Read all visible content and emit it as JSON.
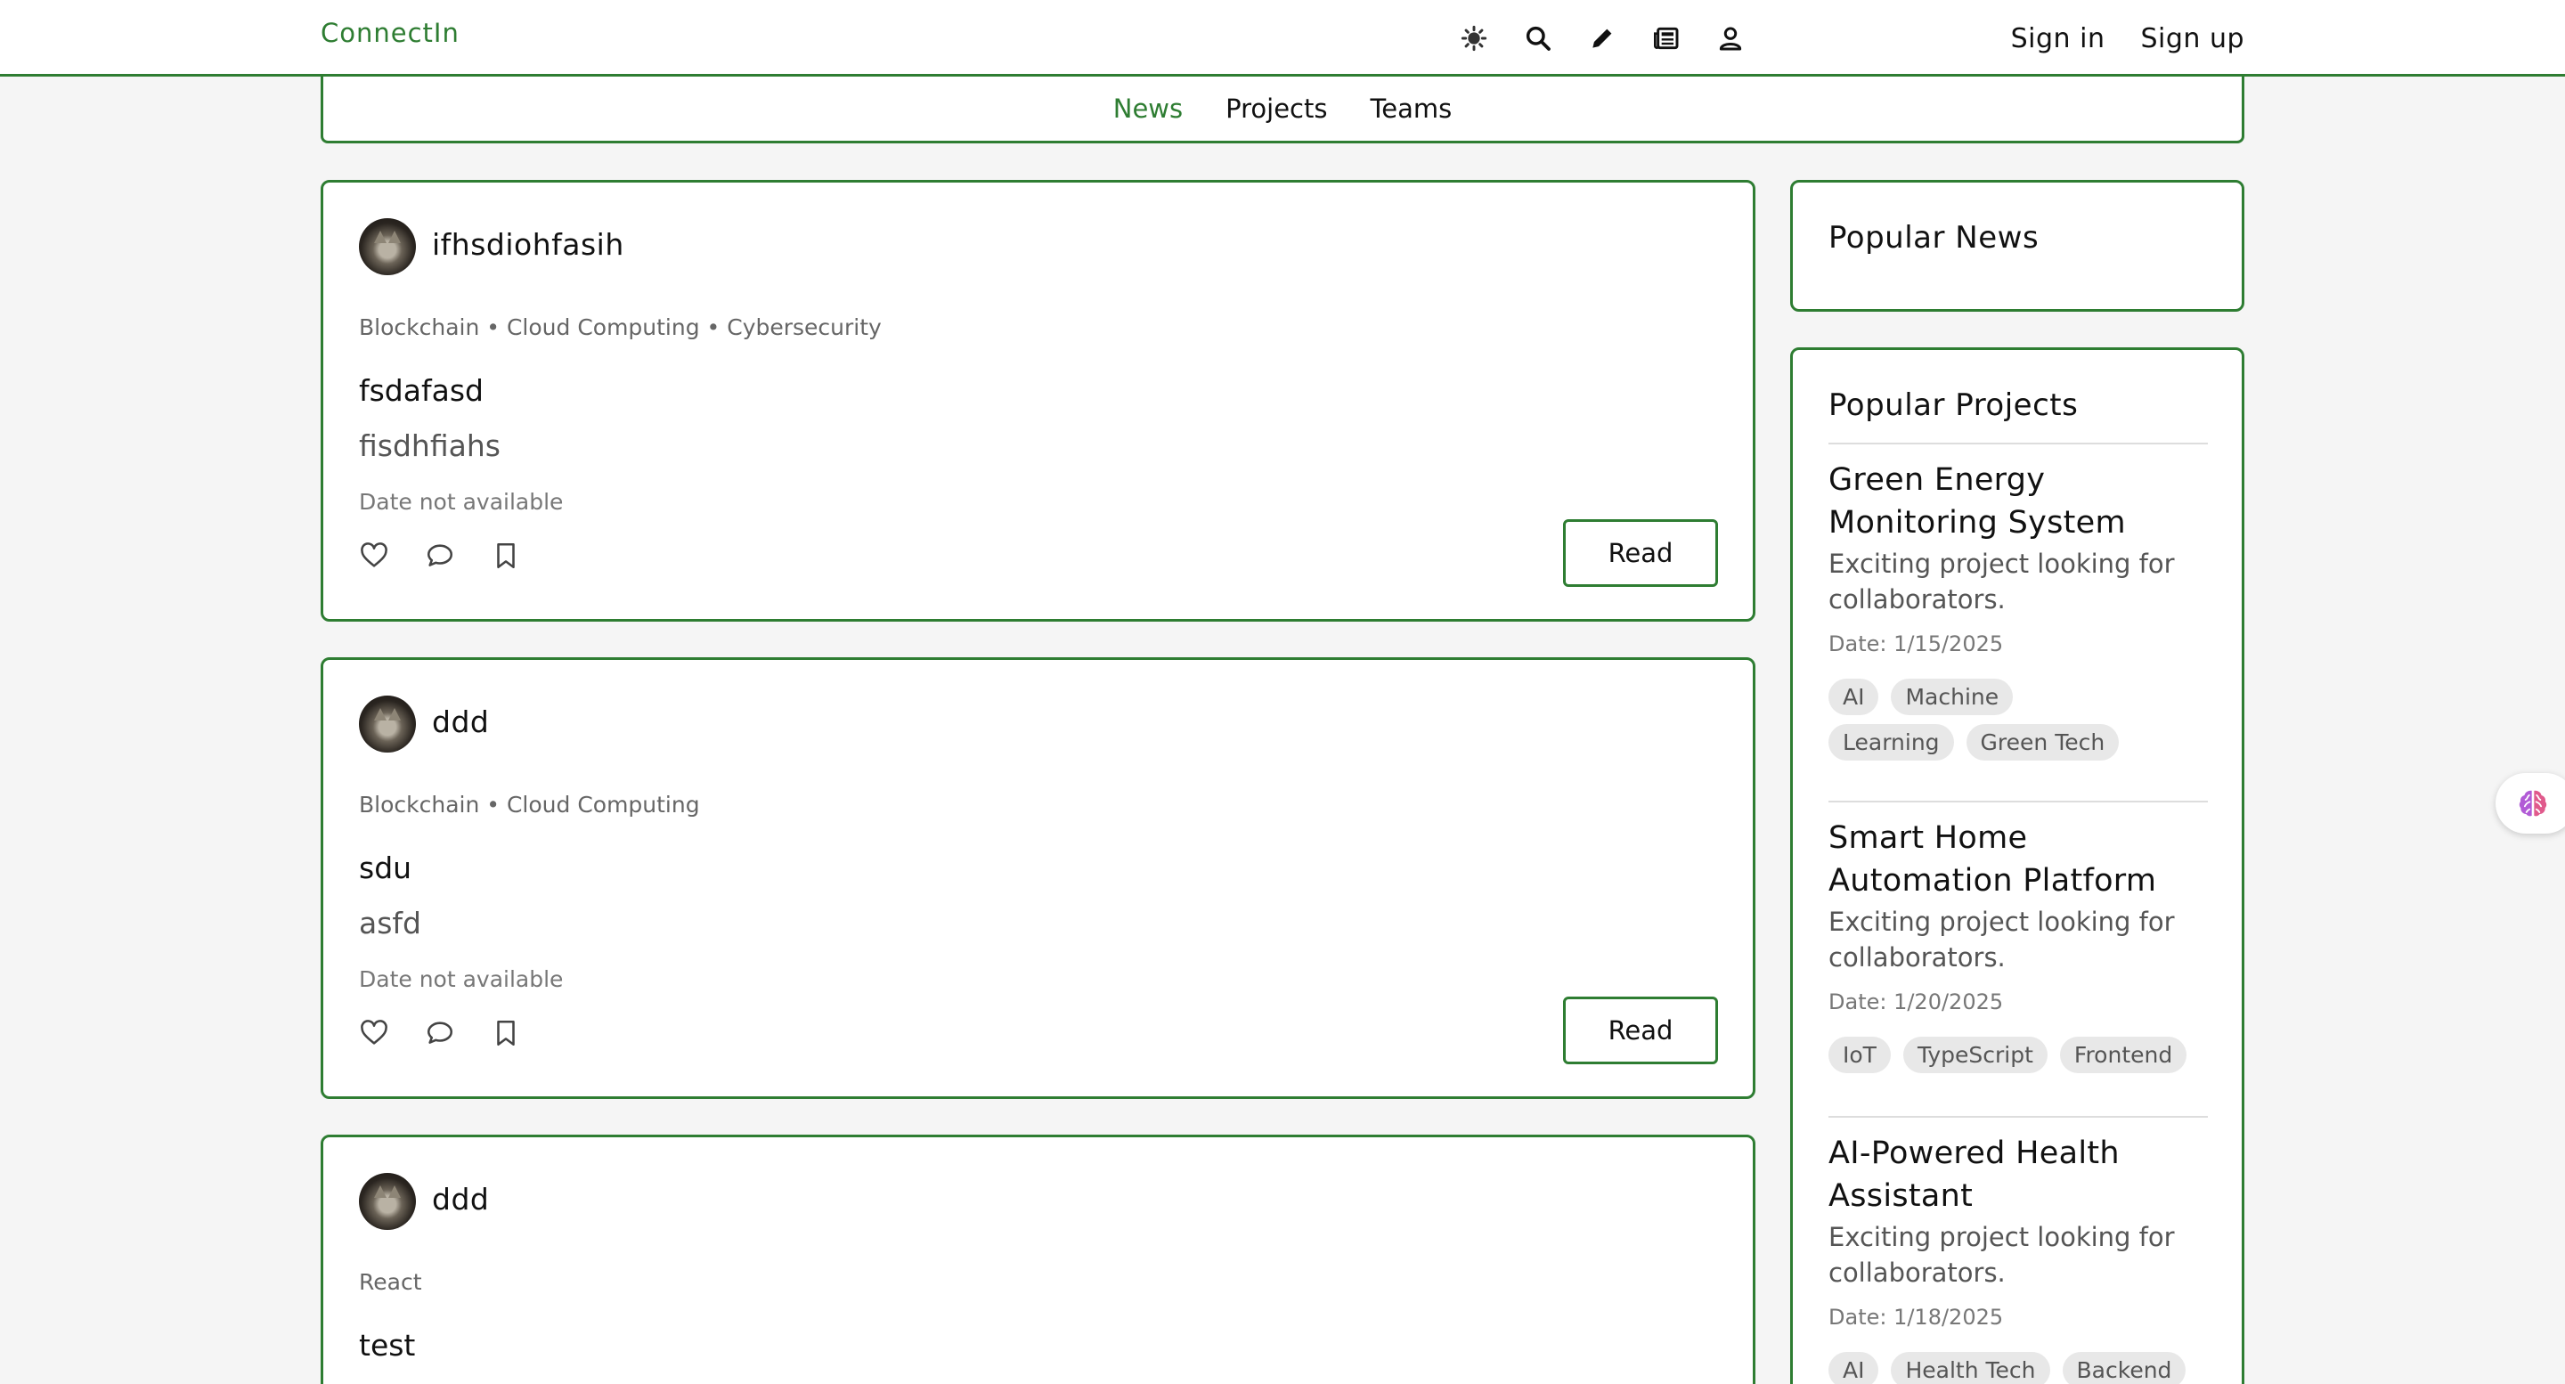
{
  "header": {
    "brand": "ConnectIn",
    "icons": [
      "theme-icon",
      "search-icon",
      "edit-icon",
      "newspaper-icon",
      "user-icon"
    ],
    "sign_in": "Sign in",
    "sign_up": "Sign up",
    "accent_color": "#2e7d32"
  },
  "tabs": [
    {
      "label": "News",
      "active": true
    },
    {
      "label": "Projects",
      "active": false
    },
    {
      "label": "Teams",
      "active": false
    }
  ],
  "posts": [
    {
      "author": "ifhsdiohfasih",
      "tags": "Blockchain • Cloud Computing • Cybersecurity",
      "title": "fsdafasd",
      "body": "fisdhfiahs",
      "date": "Date not available",
      "read_label": "Read"
    },
    {
      "author": "ddd",
      "tags": "Blockchain • Cloud Computing",
      "title": "sdu",
      "body": "asfd",
      "date": "Date not available",
      "read_label": "Read"
    },
    {
      "author": "ddd",
      "tags": "React",
      "title": "test"
    }
  ],
  "sidebar": {
    "popular_news_title": "Popular News",
    "popular_projects_title": "Popular Projects",
    "projects": [
      {
        "name": "Green Energy Monitoring System",
        "description": "Exciting project looking for collaborators.",
        "date": "Date: 1/15/2025",
        "chips": [
          "AI",
          "Machine Learning",
          "Green Tech"
        ]
      },
      {
        "name": "Smart Home Automation Platform",
        "description": "Exciting project looking for collaborators.",
        "date": "Date: 1/20/2025",
        "chips": [
          "IoT",
          "TypeScript",
          "Frontend"
        ]
      },
      {
        "name": "AI-Powered Health Assistant",
        "description": "Exciting project looking for collaborators.",
        "date": "Date: 1/18/2025",
        "chips": [
          "AI",
          "Health Tech",
          "Backend"
        ]
      }
    ]
  },
  "floating_button_icon": "brain-icon"
}
